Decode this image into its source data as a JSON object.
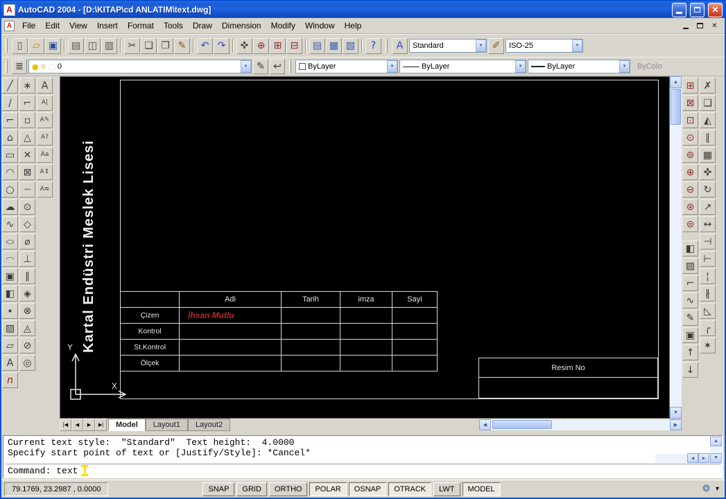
{
  "window": {
    "title": "AutoCAD 2004 - [D:\\KITAP\\cd ANLATIM\\text.dwg]"
  },
  "menu": {
    "items": [
      "File",
      "Edit",
      "View",
      "Insert",
      "Format",
      "Tools",
      "Draw",
      "Dimension",
      "Modify",
      "Window",
      "Help"
    ]
  },
  "standard_toolbar": {
    "icons": [
      {
        "name": "new-file",
        "glyph": "▯",
        "color": "#505050"
      },
      {
        "name": "open-file",
        "glyph": "▱",
        "color": "#C89010"
      },
      {
        "name": "save-file",
        "glyph": "▣",
        "color": "#2F4E9E"
      },
      {
        "sep": true
      },
      {
        "name": "plot",
        "glyph": "▤",
        "color": "#50504E"
      },
      {
        "name": "plot-preview",
        "glyph": "◫",
        "color": "#50504E"
      },
      {
        "name": "publish",
        "glyph": "▥",
        "color": "#50504E"
      },
      {
        "sep": true
      },
      {
        "name": "cut",
        "glyph": "✂",
        "color": "#444444"
      },
      {
        "name": "copy",
        "glyph": "❏",
        "color": "#444444"
      },
      {
        "name": "paste",
        "glyph": "❐",
        "color": "#444444"
      },
      {
        "name": "match-properties",
        "glyph": "✎",
        "color": "#8A5A20"
      },
      {
        "sep": true
      },
      {
        "name": "undo",
        "glyph": "↶",
        "color": "#2B4FB8"
      },
      {
        "name": "redo",
        "glyph": "↷",
        "color": "#2B4FB8"
      },
      {
        "sep": true
      },
      {
        "name": "pan-realtime",
        "glyph": "✜",
        "color": "#444444"
      },
      {
        "name": "zoom-realtime",
        "glyph": "⊕",
        "color": "#8C3030"
      },
      {
        "name": "zoom-window",
        "glyph": "⊞",
        "color": "#8C3030"
      },
      {
        "name": "zoom-previous",
        "glyph": "⊟",
        "color": "#8C3030"
      },
      {
        "sep": true
      },
      {
        "name": "properties",
        "glyph": "▤",
        "color": "#3A5AA8"
      },
      {
        "name": "designcenter",
        "glyph": "▦",
        "color": "#3A5AA8"
      },
      {
        "name": "tool-palettes",
        "glyph": "▧",
        "color": "#3A5AA8"
      },
      {
        "sep": true
      },
      {
        "name": "help",
        "glyph": "?",
        "color": "#1A3FBF"
      }
    ]
  },
  "styles_toolbar": {
    "text_style_value": "Standard",
    "dim_style_value": "ISO-25"
  },
  "layers_toolbar": {
    "layer_value": "0",
    "combo_icons": [
      {
        "name": "bulb-icon",
        "glyph": "●",
        "color": "#F0C000"
      },
      {
        "name": "sun-icon",
        "glyph": "☼",
        "color": "#E09000"
      },
      {
        "name": "layer-color-swatch-icon",
        "glyph": "□",
        "color": "#DDDDDD"
      }
    ]
  },
  "object_properties": {
    "color_value": "ByLayer",
    "linetype_value": "ByLayer",
    "lineweight_value": "ByLayer",
    "plot_style_value": "ByColo"
  },
  "draw_toolbar": {
    "icons": [
      {
        "name": "line",
        "glyph": "╱"
      },
      {
        "name": "construction-line",
        "glyph": "∕"
      },
      {
        "name": "polyline",
        "glyph": "⌐"
      },
      {
        "name": "polygon",
        "glyph": "⌂"
      },
      {
        "name": "rectangle",
        "glyph": "▭"
      },
      {
        "name": "arc",
        "glyph": "◠"
      },
      {
        "name": "circle",
        "glyph": "○"
      },
      {
        "name": "revision-cloud",
        "glyph": "☁"
      },
      {
        "name": "spline",
        "glyph": "∿"
      },
      {
        "name": "ellipse",
        "glyph": "○",
        "squash": true
      },
      {
        "name": "ellipse-arc",
        "glyph": "◠",
        "squash": true
      },
      {
        "name": "insert-block",
        "glyph": "▣"
      },
      {
        "name": "make-block",
        "glyph": "◧"
      },
      {
        "name": "point",
        "glyph": "∙"
      },
      {
        "name": "hatch",
        "glyph": "▨"
      },
      {
        "name": "region",
        "glyph": "▱"
      },
      {
        "name": "multiline-text",
        "glyph": "A"
      },
      {
        "name": "red-n",
        "glyph": "n",
        "color": "#A01818",
        "italic": true
      }
    ]
  },
  "osnap_toolbar": {
    "icons": [
      {
        "name": "temporary-track-point",
        "glyph": "∗"
      },
      {
        "name": "snap-from",
        "glyph": "⌐"
      },
      {
        "name": "snap-endpoint",
        "glyph": "▫"
      },
      {
        "name": "snap-midpoint",
        "glyph": "△"
      },
      {
        "name": "snap-intersection",
        "glyph": "✕"
      },
      {
        "name": "snap-apparent-intersection",
        "glyph": "⊠"
      },
      {
        "name": "snap-extension",
        "glyph": "┄"
      },
      {
        "name": "snap-center",
        "glyph": "⊙"
      },
      {
        "name": "snap-quadrant",
        "glyph": "◇"
      },
      {
        "name": "snap-tangent",
        "glyph": "⌀"
      },
      {
        "name": "snap-perpendicular",
        "glyph": "⊥"
      },
      {
        "name": "snap-parallel",
        "glyph": "∥"
      },
      {
        "name": "snap-insert",
        "glyph": "◈"
      },
      {
        "name": "snap-node",
        "glyph": "⊗"
      },
      {
        "name": "snap-nearest",
        "glyph": "◬"
      },
      {
        "name": "snap-none",
        "glyph": "⊘"
      },
      {
        "name": "osnap-settings",
        "glyph": "◎"
      }
    ]
  },
  "text_toolbar": {
    "icons": [
      {
        "name": "multiline-text",
        "glyph": "A"
      },
      {
        "name": "single-line-text",
        "glyph": "A|"
      },
      {
        "name": "edit-text",
        "glyph": "A✎"
      },
      {
        "name": "find-replace",
        "glyph": "A?"
      },
      {
        "name": "text-style",
        "glyph": "Aa"
      },
      {
        "name": "scale-text",
        "glyph": "A↕"
      },
      {
        "name": "justify-text",
        "glyph": "A≡"
      }
    ]
  },
  "zoom_toolbar": {
    "icons": [
      {
        "name": "zoom-window",
        "glyph": "⊞",
        "color": "#8C3030"
      },
      {
        "name": "zoom-dynamic",
        "glyph": "⊠",
        "color": "#8C3030"
      },
      {
        "name": "zoom-scale",
        "glyph": "⊡",
        "color": "#8C3030"
      },
      {
        "name": "zoom-center",
        "glyph": "⊙",
        "color": "#8C3030"
      },
      {
        "name": "zoom-object",
        "glyph": "⊚",
        "color": "#8C3030"
      },
      {
        "name": "zoom-in",
        "glyph": "⊕",
        "color": "#8C3030"
      },
      {
        "name": "zoom-out",
        "glyph": "⊖",
        "color": "#8C3030"
      },
      {
        "name": "zoom-all",
        "glyph": "⊛",
        "color": "#8C3030"
      },
      {
        "name": "zoom-extents",
        "glyph": "⊜",
        "color": "#8C3030"
      }
    ]
  },
  "modify2_toolbar": {
    "icons": [
      {
        "name": "draworder",
        "glyph": "◧"
      },
      {
        "name": "edit-hatch",
        "glyph": "▨"
      },
      {
        "name": "edit-polyline",
        "glyph": "⌐"
      },
      {
        "name": "edit-spline",
        "glyph": "∿"
      },
      {
        "name": "edit-text",
        "glyph": "✎"
      },
      {
        "name": "edit-attribute",
        "glyph": "▣"
      },
      {
        "name": "draworder-front",
        "glyph": "↑"
      },
      {
        "name": "draworder-back",
        "glyph": "↓"
      }
    ]
  },
  "modify_toolbar": {
    "icons": [
      {
        "name": "erase",
        "glyph": "✗"
      },
      {
        "name": "copy-object",
        "glyph": "❏"
      },
      {
        "name": "mirror",
        "glyph": "◭"
      },
      {
        "name": "offset",
        "glyph": "∥"
      },
      {
        "name": "array",
        "glyph": "▦"
      },
      {
        "name": "move",
        "glyph": "✜"
      },
      {
        "name": "rotate",
        "glyph": "↻"
      },
      {
        "name": "scale",
        "glyph": "↗"
      },
      {
        "name": "stretch",
        "glyph": "↔"
      },
      {
        "name": "trim",
        "glyph": "⊣"
      },
      {
        "name": "extend",
        "glyph": "⊢"
      },
      {
        "name": "break-at-point",
        "glyph": "¦"
      },
      {
        "name": "break",
        "glyph": "∦"
      },
      {
        "name": "chamfer",
        "glyph": "◺"
      },
      {
        "name": "fillet",
        "glyph": "╭"
      },
      {
        "name": "explode",
        "glyph": "✶"
      }
    ]
  },
  "canvas": {
    "vertical_text": "Kartal Endüstri Meslek Lisesi",
    "title_block": {
      "headers": [
        "Adi",
        "Tarih",
        "imza",
        "Sayi"
      ],
      "rows": [
        {
          "label": "Çizen",
          "value": "İhsan Mutlu"
        },
        {
          "label": "Kontrol",
          "value": ""
        },
        {
          "label": "St.Kontrol",
          "value": ""
        },
        {
          "label": "Ölçek",
          "value": ""
        }
      ],
      "resim_no": "Resim No"
    },
    "tabs": [
      {
        "label": "Model",
        "active": true
      },
      {
        "label": "Layout1",
        "active": false
      },
      {
        "label": "Layout2",
        "active": false
      }
    ]
  },
  "command_line": {
    "history": [
      "Current text style:  \"Standard\"  Text height:  4.0000",
      "Specify start point of text or [Justify/Style]: *Cancel*"
    ],
    "prompt": "Command: text"
  },
  "status_bar": {
    "coordinates": "79.1769, 23.2987 , 0.0000",
    "buttons": [
      {
        "label": "SNAP",
        "active": false
      },
      {
        "label": "GRID",
        "active": false
      },
      {
        "label": "ORTHO",
        "active": false
      },
      {
        "label": "POLAR",
        "active": true
      },
      {
        "label": "OSNAP",
        "active": true
      },
      {
        "label": "OTRACK",
        "active": true
      },
      {
        "label": "LWT",
        "active": false
      },
      {
        "label": "MODEL",
        "active": true
      }
    ]
  }
}
